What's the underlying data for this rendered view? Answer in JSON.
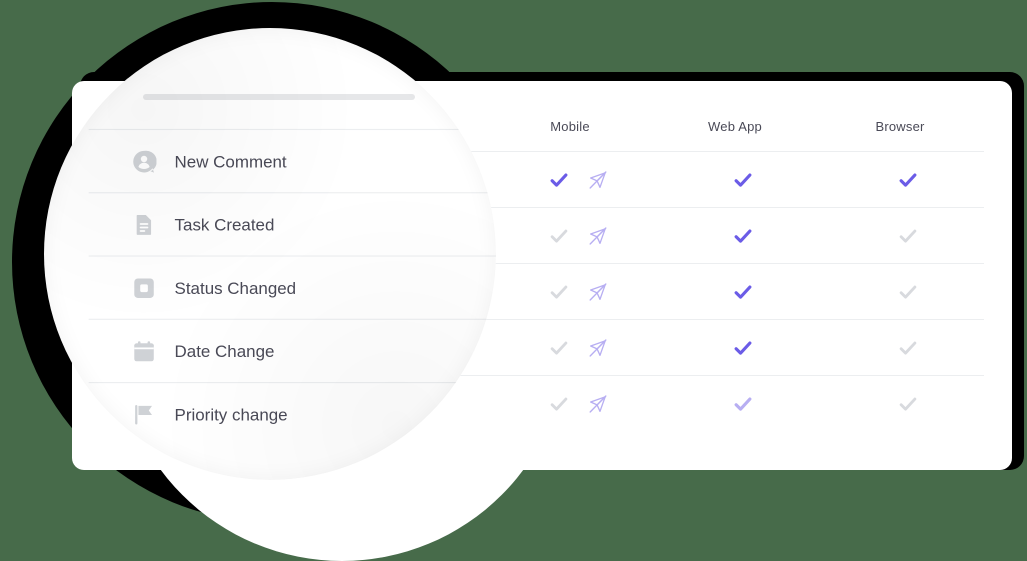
{
  "background": {
    "page_color": "#476b4a",
    "ring_color": "#000000",
    "card_color": "#ffffff"
  },
  "colors": {
    "accent_purple": "#6b5ce7",
    "accent_purple_faded": "#b7aef2",
    "inactive_gray": "#d8dade",
    "text_dark": "#4a4a57",
    "divider": "#eceef0",
    "icon_gray": "#cfd2d6"
  },
  "card": {
    "placeholder_bar": ""
  },
  "table": {
    "columns": [
      {
        "key": "mobile",
        "label": "Mobile"
      },
      {
        "key": "webapp",
        "label": "Web App"
      },
      {
        "key": "browser",
        "label": "Browser"
      }
    ],
    "rows": [
      {
        "label": "New Comment",
        "icon": "user-avatar-comment-icon",
        "mobile": {
          "check": "on",
          "mute": "muted"
        },
        "webapp": {
          "check": "on"
        },
        "browser": {
          "check": "on"
        }
      },
      {
        "label": "Task Created",
        "icon": "document-icon",
        "mobile": {
          "check": "off",
          "mute": "muted"
        },
        "webapp": {
          "check": "on"
        },
        "browser": {
          "check": "off"
        }
      },
      {
        "label": "Status Changed",
        "icon": "square-status-icon",
        "mobile": {
          "check": "off",
          "mute": "muted"
        },
        "webapp": {
          "check": "on"
        },
        "browser": {
          "check": "off"
        }
      },
      {
        "label": "Date Change",
        "icon": "calendar-icon",
        "mobile": {
          "check": "off",
          "mute": "muted"
        },
        "webapp": {
          "check": "on"
        },
        "browser": {
          "check": "off"
        }
      },
      {
        "label": "Priority change",
        "icon": "flag-icon",
        "mobile": {
          "check": "off",
          "mute": "muted"
        },
        "webapp": {
          "check": "faded"
        },
        "browser": {
          "check": "off"
        }
      }
    ]
  }
}
